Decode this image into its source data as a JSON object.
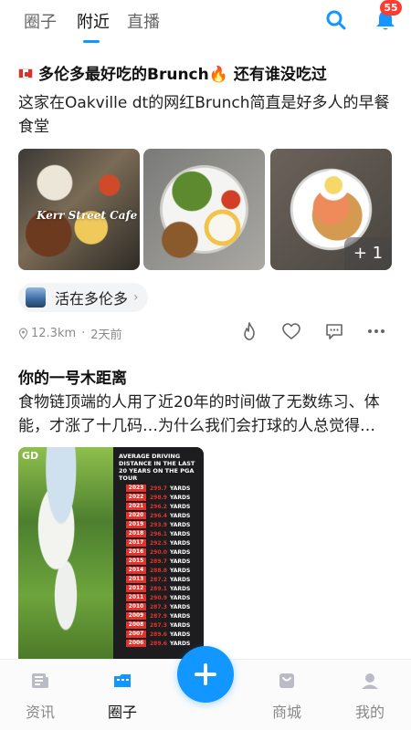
{
  "header": {
    "tabs": [
      "圈子",
      "附近",
      "直播"
    ],
    "active_tab": "附近",
    "notification_count": "55",
    "accent_color": "#1296ff"
  },
  "post1": {
    "title_flag": "canada-flag-icon",
    "title": "多伦多最好吃的Brunch",
    "title_emoji": "🔥",
    "title_tail": "还有谁没吃过",
    "body": "这家在Oakville dt的网红Brunch简直是好多人的早餐食堂",
    "image_watermark": "Kerr Street Cafe",
    "more_images": "+ 1",
    "topic": "活在多伦多",
    "distance": "12.3km",
    "time_ago": "2天前"
  },
  "post2": {
    "title": "你的一号木距离",
    "body_line1": "食物链顶端的人用了近20年的时间做了无数练习、体",
    "body_line2": "能，才涨了十几码…为什么我们会打球的人总觉得…",
    "poster": {
      "logo": "GD",
      "heading": "AVERAGE DRIVING DISTANCE IN THE LAST 20 YEARS ON THE PGA TOUR",
      "unit": "YARDS",
      "rows": [
        {
          "year": "2023",
          "yards": "299.7"
        },
        {
          "year": "2022",
          "yards": "298.9"
        },
        {
          "year": "2021",
          "yards": "296.2"
        },
        {
          "year": "2020",
          "yards": "296.4"
        },
        {
          "year": "2019",
          "yards": "293.9"
        },
        {
          "year": "2018",
          "yards": "296.1"
        },
        {
          "year": "2017",
          "yards": "292.5"
        },
        {
          "year": "2016",
          "yards": "290.0"
        },
        {
          "year": "2015",
          "yards": "289.7"
        },
        {
          "year": "2014",
          "yards": "288.8"
        },
        {
          "year": "2013",
          "yards": "287.2"
        },
        {
          "year": "2012",
          "yards": "289.1"
        },
        {
          "year": "2011",
          "yards": "290.9"
        },
        {
          "year": "2010",
          "yards": "287.3"
        },
        {
          "year": "2009",
          "yards": "287.9"
        },
        {
          "year": "2008",
          "yards": "287.3"
        },
        {
          "year": "2007",
          "yards": "289.6"
        },
        {
          "year": "2006",
          "yards": "289.6"
        }
      ]
    }
  },
  "bottom_nav": {
    "items": [
      "资讯",
      "圈子",
      "商城",
      "我的"
    ],
    "active": "圈子"
  }
}
